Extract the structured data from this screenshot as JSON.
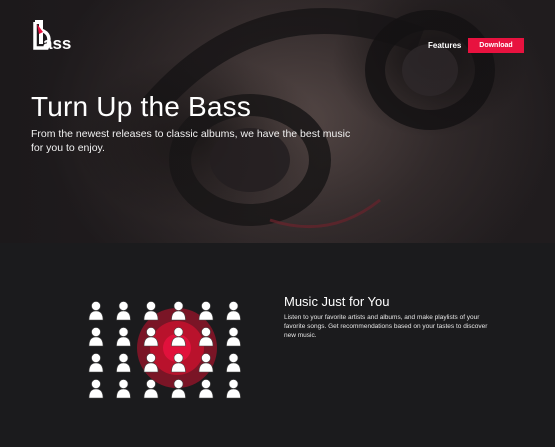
{
  "brand": {
    "logo_text": "bass",
    "accent_color": "#e8123f"
  },
  "header": {
    "nav_features_label": "Features",
    "download_label": "Download"
  },
  "hero": {
    "title": "Turn Up the Bass",
    "subtitle": "From the newest releases to classic albums, we have the best music for you to enjoy."
  },
  "feature": {
    "title": "Music Just for You",
    "text": "Listen to your favorite artists and albums, and make playlists of your favorite songs. Get recommendations based on your tastes to discover new music.",
    "illustration_icon": "listener-grid-icon"
  }
}
